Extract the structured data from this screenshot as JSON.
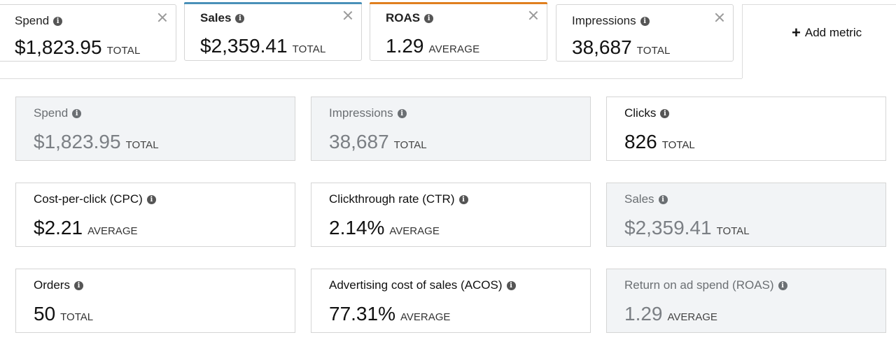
{
  "top_metrics": [
    {
      "label": "Spend",
      "value": "$1,823.95",
      "unit": "TOTAL",
      "selected": false,
      "accent": ""
    },
    {
      "label": "Sales",
      "value": "$2,359.41",
      "unit": "TOTAL",
      "selected": true,
      "accent": "#4a90b8"
    },
    {
      "label": "ROAS",
      "value": "1.29",
      "unit": "AVERAGE",
      "selected": true,
      "accent": "#e07f1f"
    },
    {
      "label": "Impressions",
      "value": "38,687",
      "unit": "TOTAL",
      "selected": false,
      "accent": ""
    }
  ],
  "add_metric": {
    "label": "Add metric"
  },
  "grid_metrics": [
    {
      "label": "Spend",
      "value": "$1,823.95",
      "unit": "TOTAL",
      "disabled": true
    },
    {
      "label": "Impressions",
      "value": "38,687",
      "unit": "TOTAL",
      "disabled": true
    },
    {
      "label": "Clicks",
      "value": "826",
      "unit": "TOTAL",
      "disabled": false
    },
    {
      "label": "Cost-per-click (CPC)",
      "value": "$2.21",
      "unit": "AVERAGE",
      "disabled": false
    },
    {
      "label": "Clickthrough rate (CTR)",
      "value": "2.14%",
      "unit": "AVERAGE",
      "disabled": false
    },
    {
      "label": "Sales",
      "value": "$2,359.41",
      "unit": "TOTAL",
      "disabled": true
    },
    {
      "label": "Orders",
      "value": "50",
      "unit": "TOTAL",
      "disabled": false
    },
    {
      "label": "Advertising cost of sales (ACOS)",
      "value": "77.31%",
      "unit": "AVERAGE",
      "disabled": false
    },
    {
      "label": "Return on ad spend (ROAS)",
      "value": "1.29",
      "unit": "AVERAGE",
      "disabled": true
    }
  ],
  "icons": {
    "info": "info-icon",
    "close": "close-icon",
    "add": "plus-icon"
  },
  "colors": {
    "sales_accent": "#4a90b8",
    "roas_accent": "#e07f1f",
    "disabled_bg": "#f2f4f6"
  }
}
